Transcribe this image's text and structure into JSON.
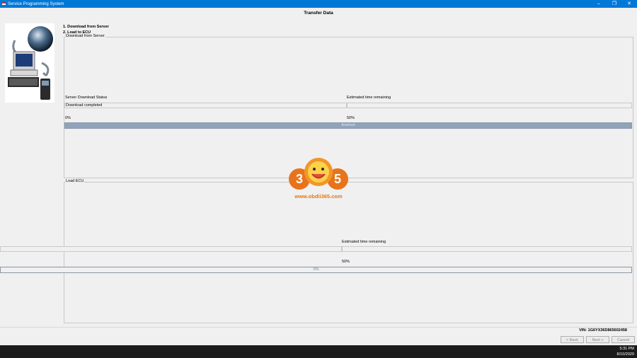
{
  "window": {
    "title": "Service Programming System",
    "controls": [
      "minimize-icon",
      "restore-icon",
      "close-icon"
    ],
    "accent_color": "#0078d7"
  },
  "page": {
    "title": "Transfer Data"
  },
  "steps": [
    "1. Download from Server",
    "2. Load to ECU"
  ],
  "download": {
    "group_label": "Download from Server",
    "status_label": "Server Download Status",
    "status_value": "Download completed",
    "time_label": "Estimated time remaining",
    "time_value": "",
    "progress_left_label": "0%",
    "progress_mid_label": "50%",
    "progress_text": "finished",
    "progress_fraction": 1.0
  },
  "load": {
    "group_label": "Load ECU",
    "time_label": "Estimated time remaining",
    "time_value": "",
    "progress_mid_label": "50%",
    "progress_text": "0%",
    "progress_fraction": 0.0
  },
  "watermark": {
    "text": "www.obdii365.com",
    "badge": "365"
  },
  "vin": "VIN: 1G6YX36D865602458",
  "nav": {
    "back": "< Back",
    "next": "Next >",
    "cancel": "Cancel"
  },
  "taskbar": {
    "time": "5:31 PM",
    "date": "8/10/2020"
  }
}
